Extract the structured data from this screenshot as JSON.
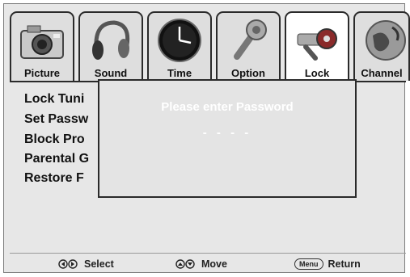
{
  "tabs": [
    {
      "label": "Picture",
      "icon": "camera-icon",
      "active": false
    },
    {
      "label": "Sound",
      "icon": "headphones-icon",
      "active": false
    },
    {
      "label": "Time",
      "icon": "clock-icon",
      "active": false
    },
    {
      "label": "Option",
      "icon": "wrench-icon",
      "active": false
    },
    {
      "label": "Lock",
      "icon": "keys-icon",
      "active": true
    },
    {
      "label": "Channel",
      "icon": "globe-icon",
      "active": false
    }
  ],
  "menu": {
    "items": [
      "Lock Tuni",
      "Set Passw",
      "Block Pro",
      "Parental G",
      "Restore F"
    ]
  },
  "dialog": {
    "title": "Please enter Password",
    "password_mask": "- - - -"
  },
  "footer": {
    "select": {
      "glyph": "left-right-arrows-icon",
      "label": "Select"
    },
    "move": {
      "glyph": "up-down-arrows-icon",
      "label": "Move"
    },
    "return": {
      "key": "Menu",
      "label": "Return"
    }
  },
  "colors": {
    "active_tab": "#ffffff",
    "background": "#e7e7e7",
    "border": "#2a2a2a",
    "dialog_text": "#ffffff"
  }
}
